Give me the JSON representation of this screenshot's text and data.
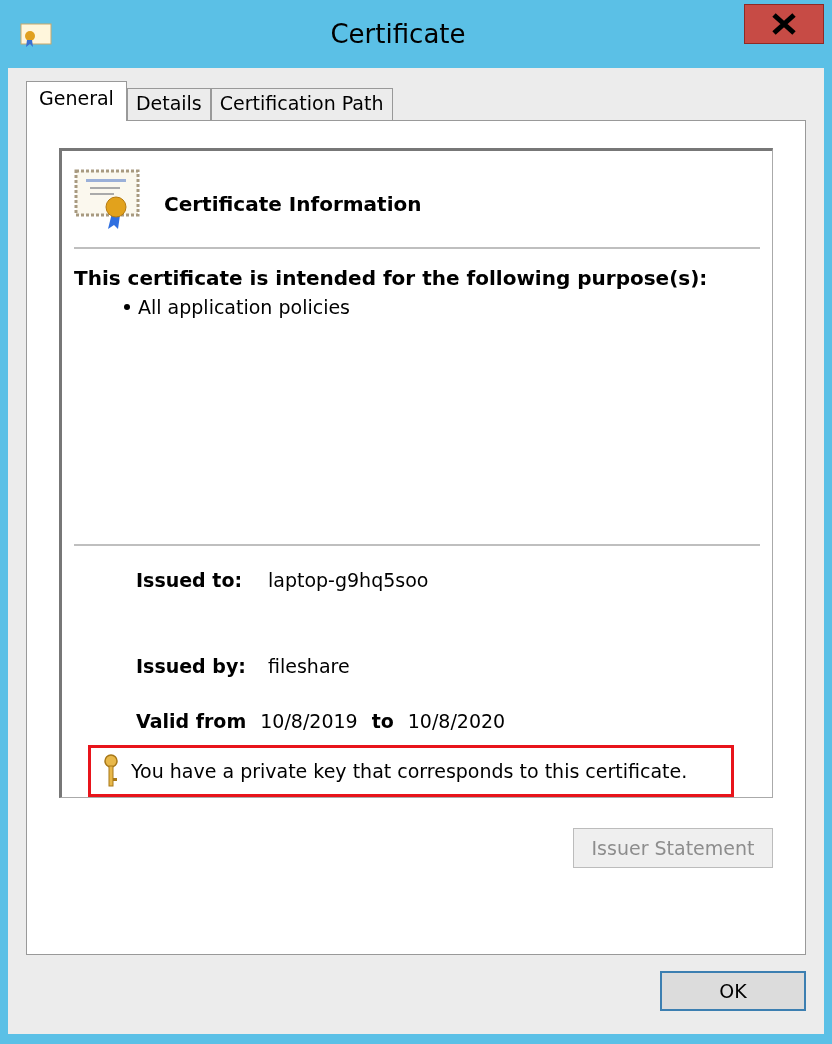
{
  "window": {
    "title": "Certificate"
  },
  "tabs": [
    {
      "label": "General",
      "selected": true
    },
    {
      "label": "Details",
      "selected": false
    },
    {
      "label": "Certification Path",
      "selected": false
    }
  ],
  "info": {
    "title": "Certificate Information",
    "purpose_heading": "This certificate is intended for the following purpose(s):",
    "purposes": [
      "All application policies"
    ]
  },
  "fields": [
    {
      "label": "Issued to:",
      "value": "laptop-g9hq5soo"
    },
    {
      "label": "Issued by:",
      "value": "fileshare"
    }
  ],
  "validity": {
    "label": "Valid from",
    "from": "10/8/2019",
    "to_label": "to",
    "to": "10/8/2020"
  },
  "key_note": {
    "text": "You have a private key that corresponds to this certificate.",
    "highlighted": true
  },
  "buttons": [
    {
      "label": "Issuer Statement",
      "disabled": true
    },
    {
      "label": "OK",
      "disabled": false
    }
  ]
}
